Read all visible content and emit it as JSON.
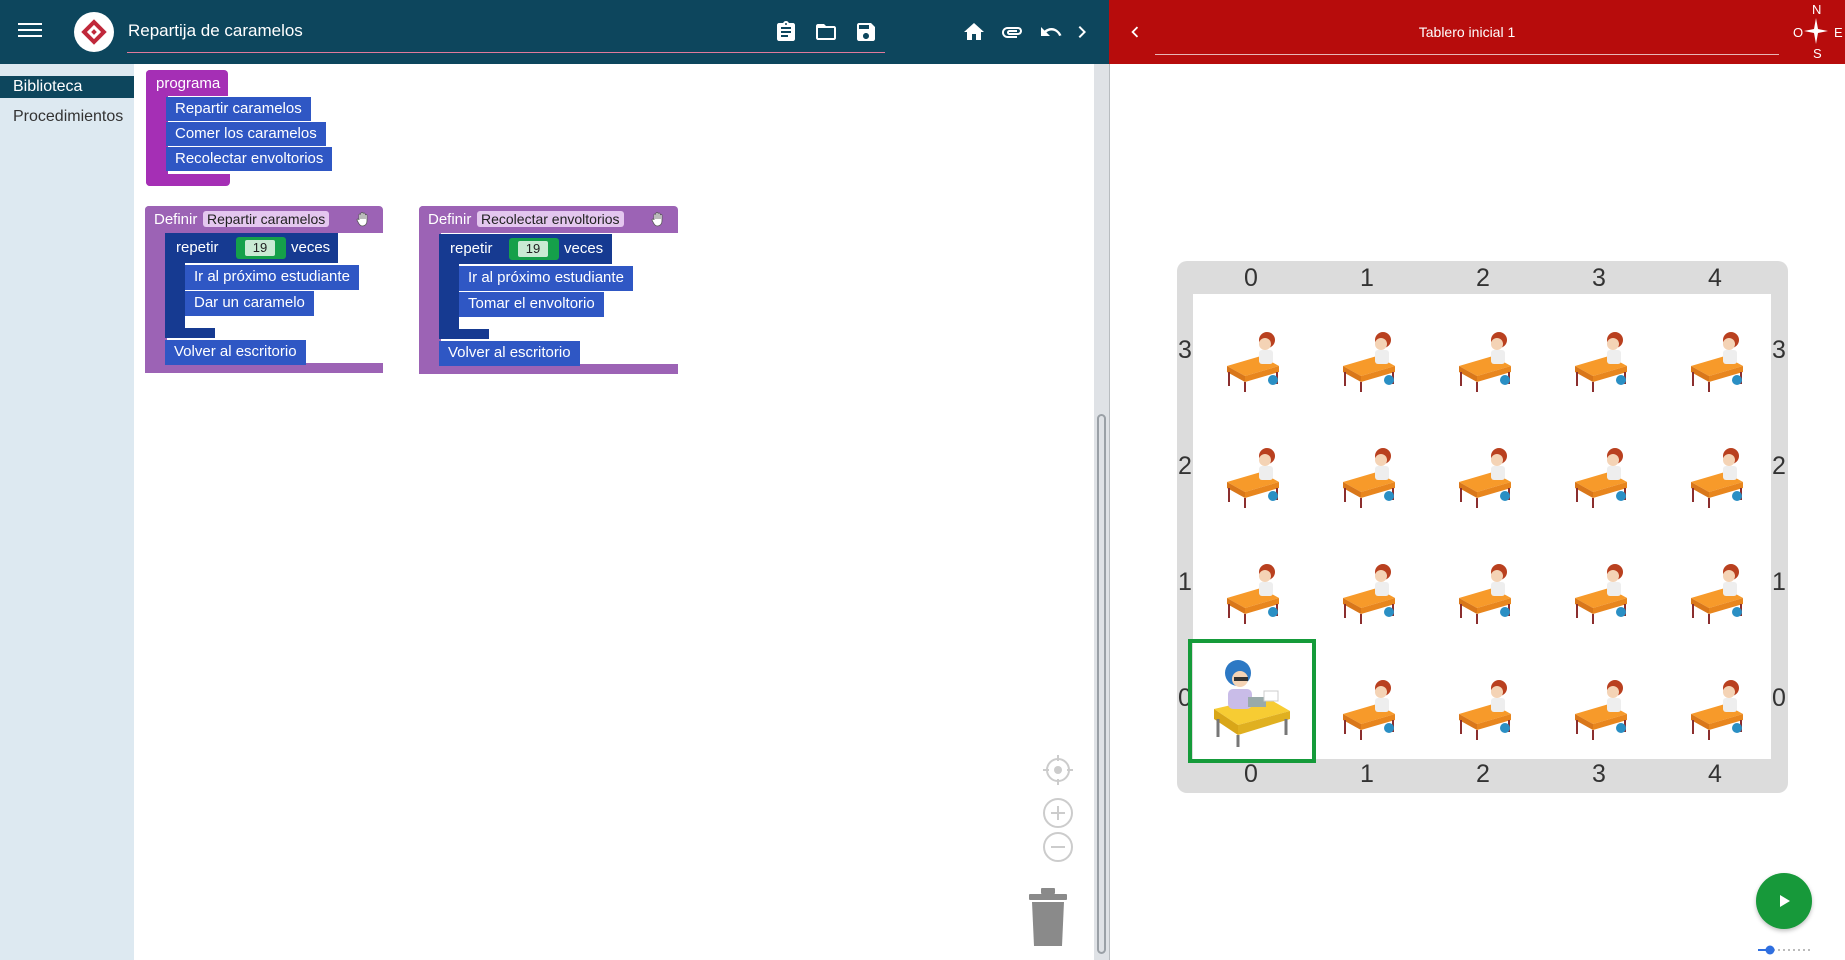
{
  "header": {
    "title": "Repartija de caramelos",
    "icons": [
      "menu-icon",
      "app-logo",
      "clipboard-icon",
      "folder-icon",
      "save-icon",
      "home-icon",
      "attach-icon",
      "undo-icon",
      "chevron-right-icon"
    ]
  },
  "sidebar": {
    "tabs": [
      {
        "label": "Biblioteca",
        "active": true
      },
      {
        "label": "Procedimientos",
        "active": false
      }
    ]
  },
  "workspace": {
    "program": {
      "hat": "programa",
      "calls": [
        "Repartir caramelos",
        "Comer los caramelos",
        "Recolectar envoltorios"
      ]
    },
    "def1": {
      "keyword": "Definir",
      "name": "Repartir caramelos",
      "repeat_label": "repetir",
      "repeat_count": "19",
      "repeat_suffix": "veces",
      "body": [
        "Ir al próximo estudiante",
        "Dar un caramelo"
      ],
      "after": "Volver al escritorio"
    },
    "def2": {
      "keyword": "Definir",
      "name": "Recolectar envoltorios",
      "repeat_label": "repetir",
      "repeat_count": "19",
      "repeat_suffix": "veces",
      "body": [
        "Ir al próximo estudiante",
        "Tomar el envoltorio"
      ],
      "after": "Volver al escritorio"
    }
  },
  "board": {
    "title": "Tablero inicial 1",
    "compass": {
      "n": "N",
      "s": "S",
      "o": "O",
      "e": "E"
    },
    "columns": [
      "0",
      "1",
      "2",
      "3",
      "4"
    ],
    "rows": [
      "3",
      "2",
      "1",
      "0"
    ],
    "player_cell": {
      "col": 0,
      "row": 0
    },
    "colors": {
      "header": "#b70c0c",
      "player_frame": "#159b3a",
      "play_button": "#17993a"
    }
  },
  "colors": {
    "left_header": "#0d465d",
    "sidebar": "#dde9f1"
  }
}
